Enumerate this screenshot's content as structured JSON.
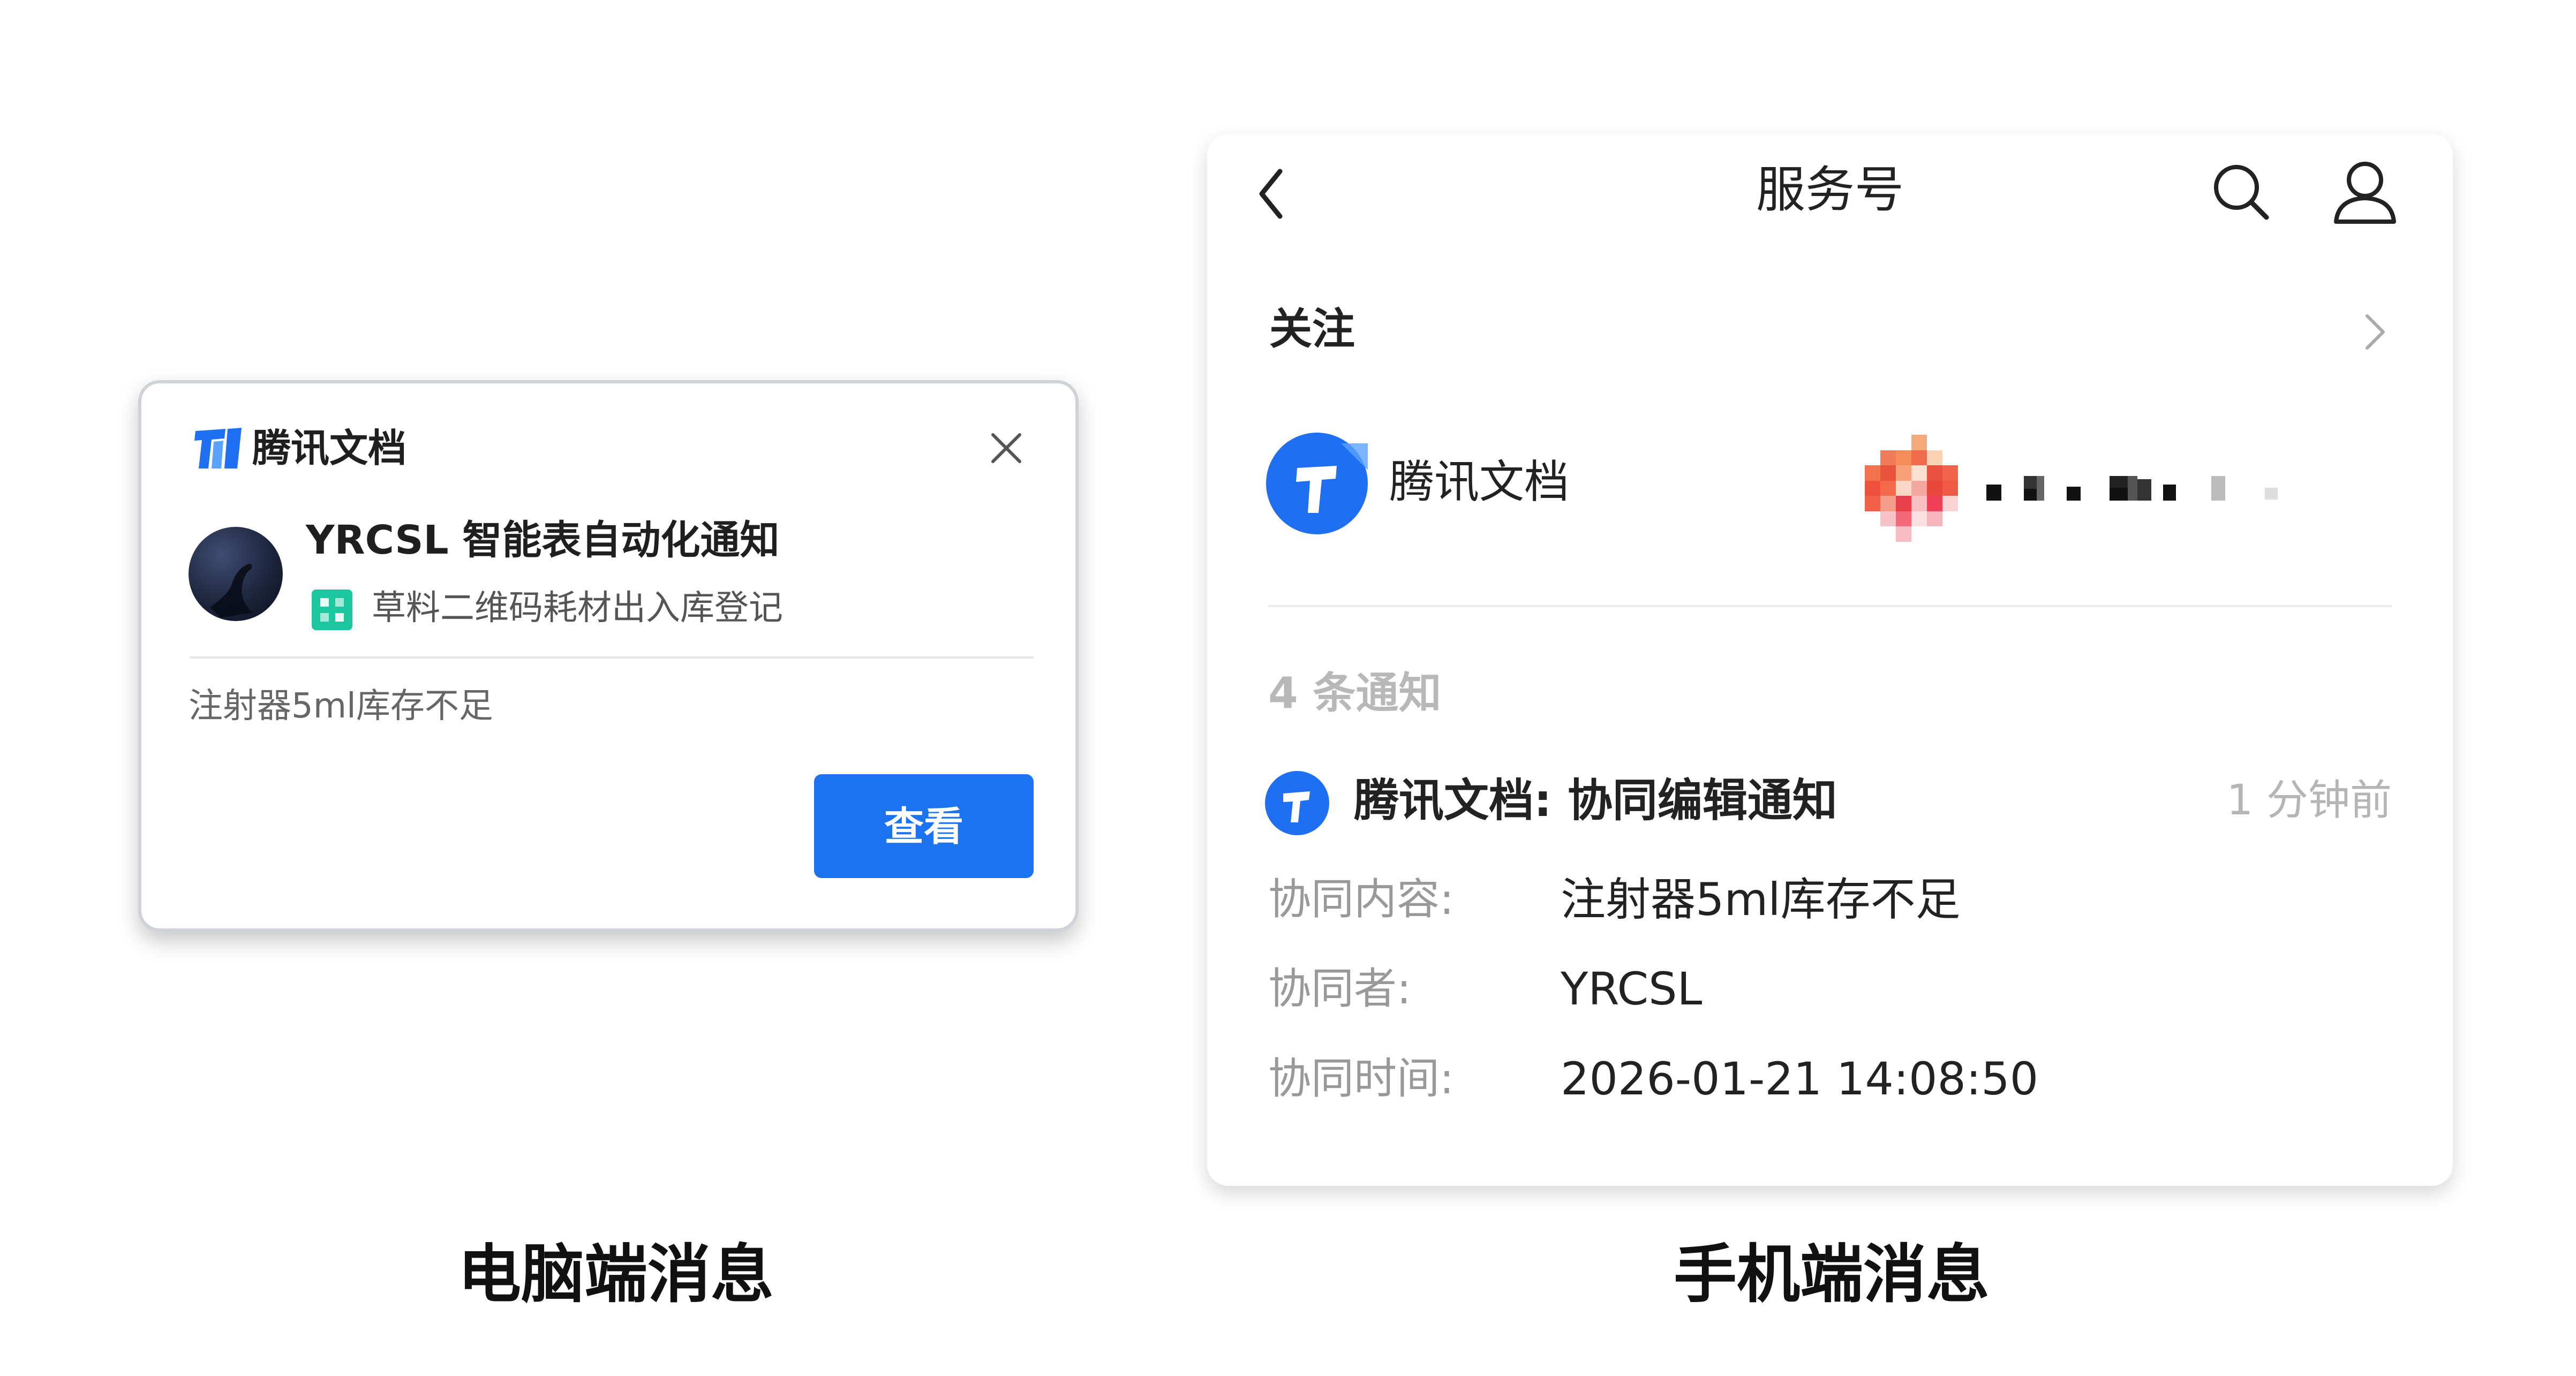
{
  "desktop": {
    "brand": "腾讯文档",
    "title": "YRCSL 智能表自动化通知",
    "subtitle": "草料二维码耗材出入库登记",
    "message": "注射器5ml库存不足",
    "view_button": "查看",
    "icons": {
      "brand": "tencent-docs-icon",
      "close": "close-icon",
      "sheet": "smart-sheet-icon"
    },
    "colors": {
      "button": "#1b73f0",
      "brand_blue": "#1e6ff1",
      "sheet_green": "#1cc7a0"
    }
  },
  "captions": {
    "desktop": "电脑端消息",
    "mobile": "手机端消息"
  },
  "mobile": {
    "header_title": "服务号",
    "follow_label": "关注",
    "account_name": "腾讯文档",
    "notification_count": "4 条通知",
    "notification": {
      "title": "腾讯文档:  协同编辑通知",
      "time": "1 分钟前",
      "fields": [
        {
          "label": "协同内容:",
          "value": "注射器5ml库存不足"
        },
        {
          "label": "协同者:",
          "value": "YRCSL"
        },
        {
          "label": "协同时间:",
          "value": "2026-01-21 14:08:50"
        }
      ]
    },
    "icons": {
      "back": "back-arrow-icon",
      "search": "search-icon",
      "user": "user-icon",
      "chevron": "chevron-right-icon"
    }
  }
}
